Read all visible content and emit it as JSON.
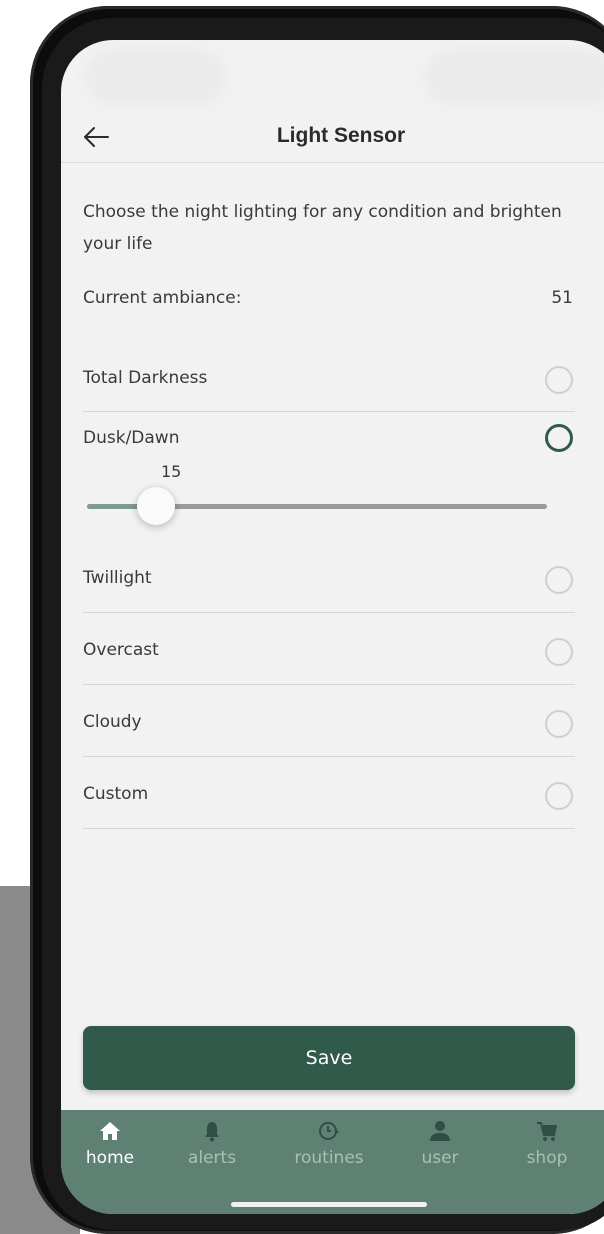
{
  "header": {
    "title": "Light Sensor"
  },
  "description": "Choose the night lighting for any condition and brighten your life",
  "ambiance": {
    "label": "Current ambiance:",
    "value": "51"
  },
  "options": [
    {
      "label": "Total Darkness",
      "selected": false
    },
    {
      "label": "Dusk/Dawn",
      "selected": true
    },
    {
      "label": "Twillight",
      "selected": false
    },
    {
      "label": "Overcast",
      "selected": false
    },
    {
      "label": "Cloudy",
      "selected": false
    },
    {
      "label": "Custom",
      "selected": false
    }
  ],
  "slider": {
    "value": "15",
    "min": 0,
    "max": 100
  },
  "save_label": "Save",
  "tabs": [
    {
      "label": "home",
      "icon": "home-icon",
      "active": true
    },
    {
      "label": "alerts",
      "icon": "bell-icon",
      "active": false
    },
    {
      "label": "routines",
      "icon": "clock-icon",
      "active": false
    },
    {
      "label": "user",
      "icon": "user-icon",
      "active": false
    },
    {
      "label": "shop",
      "icon": "cart-icon",
      "active": false
    }
  ],
  "colors": {
    "accent": "#315a4b",
    "tabbar": "#5e8173",
    "slider_fill": "#7e9b8e",
    "background": "#f2f2f2"
  }
}
